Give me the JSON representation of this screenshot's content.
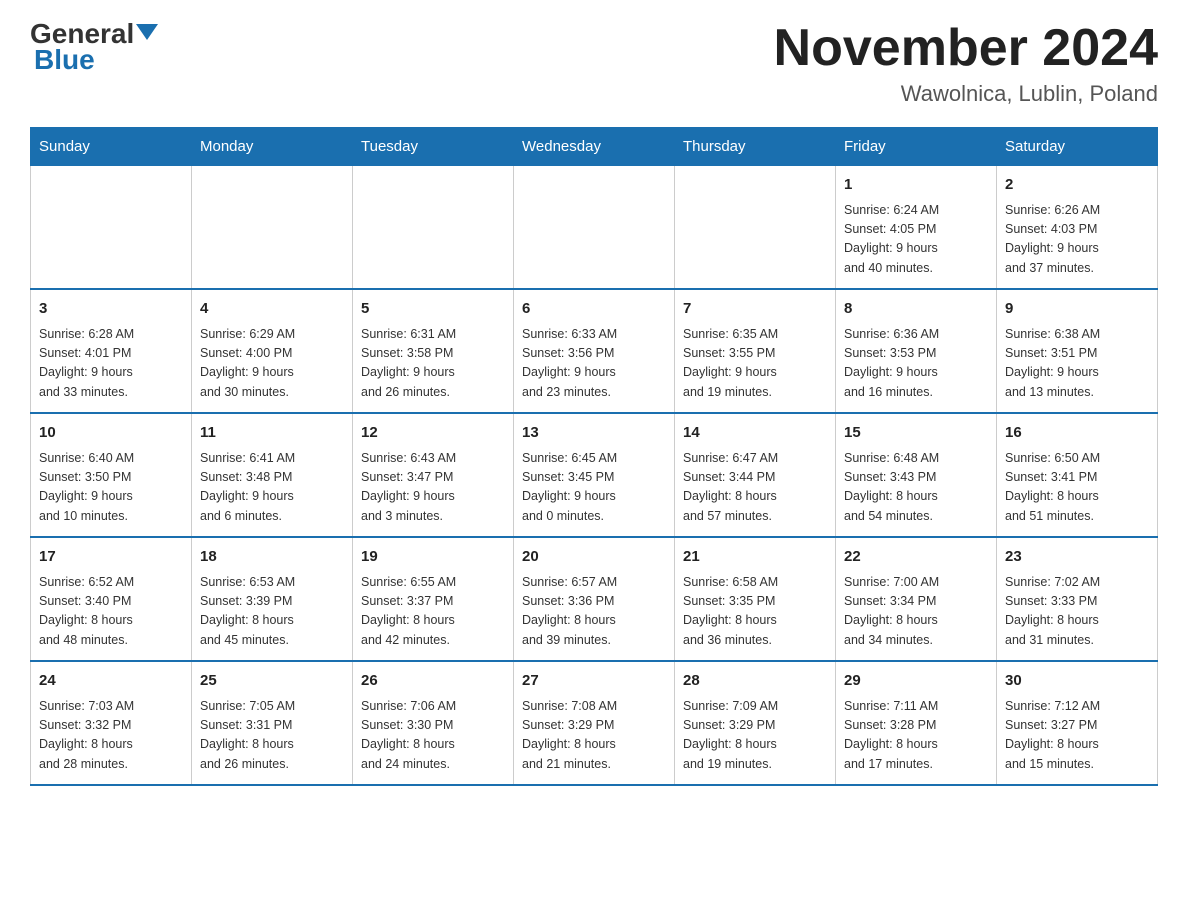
{
  "header": {
    "logo_general": "General",
    "logo_blue": "Blue",
    "title": "November 2024",
    "subtitle": "Wawolnica, Lublin, Poland"
  },
  "days_of_week": [
    "Sunday",
    "Monday",
    "Tuesday",
    "Wednesday",
    "Thursday",
    "Friday",
    "Saturday"
  ],
  "weeks": [
    [
      {
        "day": "",
        "info": ""
      },
      {
        "day": "",
        "info": ""
      },
      {
        "day": "",
        "info": ""
      },
      {
        "day": "",
        "info": ""
      },
      {
        "day": "",
        "info": ""
      },
      {
        "day": "1",
        "info": "Sunrise: 6:24 AM\nSunset: 4:05 PM\nDaylight: 9 hours\nand 40 minutes."
      },
      {
        "day": "2",
        "info": "Sunrise: 6:26 AM\nSunset: 4:03 PM\nDaylight: 9 hours\nand 37 minutes."
      }
    ],
    [
      {
        "day": "3",
        "info": "Sunrise: 6:28 AM\nSunset: 4:01 PM\nDaylight: 9 hours\nand 33 minutes."
      },
      {
        "day": "4",
        "info": "Sunrise: 6:29 AM\nSunset: 4:00 PM\nDaylight: 9 hours\nand 30 minutes."
      },
      {
        "day": "5",
        "info": "Sunrise: 6:31 AM\nSunset: 3:58 PM\nDaylight: 9 hours\nand 26 minutes."
      },
      {
        "day": "6",
        "info": "Sunrise: 6:33 AM\nSunset: 3:56 PM\nDaylight: 9 hours\nand 23 minutes."
      },
      {
        "day": "7",
        "info": "Sunrise: 6:35 AM\nSunset: 3:55 PM\nDaylight: 9 hours\nand 19 minutes."
      },
      {
        "day": "8",
        "info": "Sunrise: 6:36 AM\nSunset: 3:53 PM\nDaylight: 9 hours\nand 16 minutes."
      },
      {
        "day": "9",
        "info": "Sunrise: 6:38 AM\nSunset: 3:51 PM\nDaylight: 9 hours\nand 13 minutes."
      }
    ],
    [
      {
        "day": "10",
        "info": "Sunrise: 6:40 AM\nSunset: 3:50 PM\nDaylight: 9 hours\nand 10 minutes."
      },
      {
        "day": "11",
        "info": "Sunrise: 6:41 AM\nSunset: 3:48 PM\nDaylight: 9 hours\nand 6 minutes."
      },
      {
        "day": "12",
        "info": "Sunrise: 6:43 AM\nSunset: 3:47 PM\nDaylight: 9 hours\nand 3 minutes."
      },
      {
        "day": "13",
        "info": "Sunrise: 6:45 AM\nSunset: 3:45 PM\nDaylight: 9 hours\nand 0 minutes."
      },
      {
        "day": "14",
        "info": "Sunrise: 6:47 AM\nSunset: 3:44 PM\nDaylight: 8 hours\nand 57 minutes."
      },
      {
        "day": "15",
        "info": "Sunrise: 6:48 AM\nSunset: 3:43 PM\nDaylight: 8 hours\nand 54 minutes."
      },
      {
        "day": "16",
        "info": "Sunrise: 6:50 AM\nSunset: 3:41 PM\nDaylight: 8 hours\nand 51 minutes."
      }
    ],
    [
      {
        "day": "17",
        "info": "Sunrise: 6:52 AM\nSunset: 3:40 PM\nDaylight: 8 hours\nand 48 minutes."
      },
      {
        "day": "18",
        "info": "Sunrise: 6:53 AM\nSunset: 3:39 PM\nDaylight: 8 hours\nand 45 minutes."
      },
      {
        "day": "19",
        "info": "Sunrise: 6:55 AM\nSunset: 3:37 PM\nDaylight: 8 hours\nand 42 minutes."
      },
      {
        "day": "20",
        "info": "Sunrise: 6:57 AM\nSunset: 3:36 PM\nDaylight: 8 hours\nand 39 minutes."
      },
      {
        "day": "21",
        "info": "Sunrise: 6:58 AM\nSunset: 3:35 PM\nDaylight: 8 hours\nand 36 minutes."
      },
      {
        "day": "22",
        "info": "Sunrise: 7:00 AM\nSunset: 3:34 PM\nDaylight: 8 hours\nand 34 minutes."
      },
      {
        "day": "23",
        "info": "Sunrise: 7:02 AM\nSunset: 3:33 PM\nDaylight: 8 hours\nand 31 minutes."
      }
    ],
    [
      {
        "day": "24",
        "info": "Sunrise: 7:03 AM\nSunset: 3:32 PM\nDaylight: 8 hours\nand 28 minutes."
      },
      {
        "day": "25",
        "info": "Sunrise: 7:05 AM\nSunset: 3:31 PM\nDaylight: 8 hours\nand 26 minutes."
      },
      {
        "day": "26",
        "info": "Sunrise: 7:06 AM\nSunset: 3:30 PM\nDaylight: 8 hours\nand 24 minutes."
      },
      {
        "day": "27",
        "info": "Sunrise: 7:08 AM\nSunset: 3:29 PM\nDaylight: 8 hours\nand 21 minutes."
      },
      {
        "day": "28",
        "info": "Sunrise: 7:09 AM\nSunset: 3:29 PM\nDaylight: 8 hours\nand 19 minutes."
      },
      {
        "day": "29",
        "info": "Sunrise: 7:11 AM\nSunset: 3:28 PM\nDaylight: 8 hours\nand 17 minutes."
      },
      {
        "day": "30",
        "info": "Sunrise: 7:12 AM\nSunset: 3:27 PM\nDaylight: 8 hours\nand 15 minutes."
      }
    ]
  ]
}
